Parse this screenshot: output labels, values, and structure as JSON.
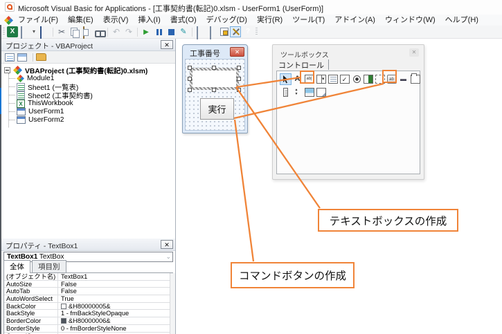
{
  "title_bar": {
    "title": "Microsoft Visual Basic for Applications - [工事契約書(転記)0.xlsm - UserForm1 (UserForm)]"
  },
  "menu": {
    "items": [
      "ファイル(F)",
      "編集(E)",
      "表示(V)",
      "挿入(I)",
      "書式(O)",
      "デバッグ(D)",
      "実行(R)",
      "ツール(T)",
      "アドイン(A)",
      "ウィンドウ(W)",
      "ヘルプ(H)"
    ]
  },
  "toolbar": {
    "icons": [
      "view-excel-icon",
      "insert-userform-icon",
      "save-icon",
      "cut-icon",
      "copy-icon",
      "paste-icon",
      "find-icon",
      "undo-icon",
      "redo-icon",
      "run-icon",
      "break-icon",
      "reset-icon",
      "design-mode-icon",
      "project-explorer-icon",
      "properties-window-icon",
      "object-browser-icon",
      "toolbox-icon",
      "help-icon"
    ]
  },
  "project_panel": {
    "header": "プロジェクト - VBAProject",
    "tree": {
      "root": "VBAProject (工事契約書(転記)0.xlsm)",
      "items": [
        {
          "label": "Module1",
          "icon": "module-icon"
        },
        {
          "label": "Sheet1 (一覧表)",
          "icon": "worksheet-icon"
        },
        {
          "label": "Sheet2 (工事契約書)",
          "icon": "worksheet-icon"
        },
        {
          "label": "ThisWorkbook",
          "icon": "workbook-icon"
        },
        {
          "label": "UserForm1",
          "icon": "userform-icon"
        },
        {
          "label": "UserForm2",
          "icon": "userform-icon"
        }
      ]
    }
  },
  "form_window": {
    "title": "工事番号",
    "run_button_label": "実行"
  },
  "toolbox": {
    "title": "ツールボックス",
    "tab": "コントロール",
    "icons": [
      "select-icon",
      "label-icon",
      "textbox-icon",
      "combobox-icon",
      "listbox-icon",
      "checkbox-icon",
      "optionbutton-icon",
      "togglebutton-icon",
      "frame-icon",
      "commandbutton-icon",
      "tabstrip-icon",
      "multipage-icon",
      "scrollbar-icon",
      "spinbutton-icon",
      "image-icon",
      "refedit-icon"
    ],
    "highlighted": [
      "textbox-icon",
      "commandbutton-icon"
    ]
  },
  "properties_panel": {
    "header": "プロパティ - TextBox1",
    "object_name": "TextBox1",
    "object_type": "TextBox",
    "tabs": [
      "全体",
      "項目別"
    ],
    "rows": [
      {
        "name": "(オブジェクト名)",
        "value": "TextBox1"
      },
      {
        "name": "AutoSize",
        "value": "False"
      },
      {
        "name": "AutoTab",
        "value": "False"
      },
      {
        "name": "AutoWordSelect",
        "value": "True"
      },
      {
        "name": "BackColor",
        "value": "&H80000005&",
        "swatch": "#ffffff"
      },
      {
        "name": "BackStyle",
        "value": "1 - fmBackStyleOpaque"
      },
      {
        "name": "BorderColor",
        "value": "&H80000006&",
        "swatch": "#4f565e"
      },
      {
        "name": "BorderStyle",
        "value": "0 - fmBorderStyleNone"
      },
      {
        "name": "ControlSource",
        "value": ""
      }
    ]
  },
  "annotations": {
    "accent_color": "#F08438",
    "textbox_callout": "テキストボックスの作成",
    "commandbutton_callout": "コマンドボタンの作成"
  }
}
